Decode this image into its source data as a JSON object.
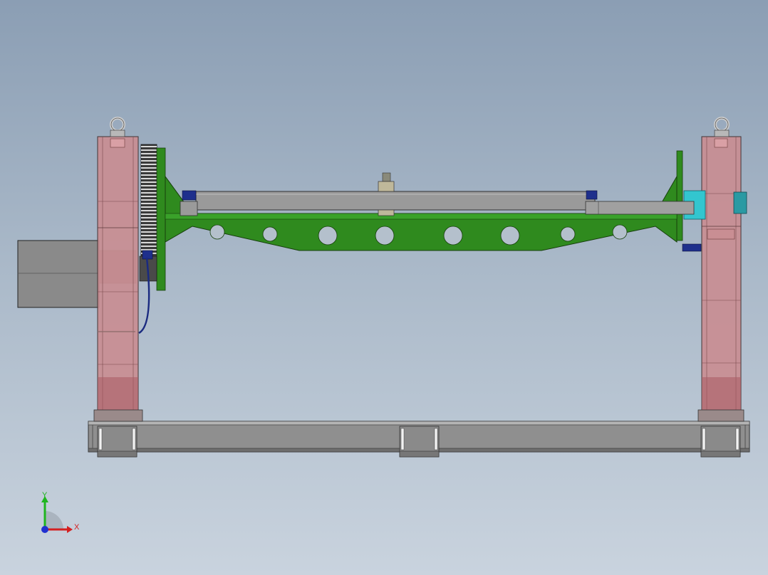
{
  "view": {
    "background_top": "#8b9eb4",
    "background_bottom": "#c9d3de"
  },
  "model": {
    "colors": {
      "frame_red": "#c98e93",
      "frame_red_dark": "#9c6268",
      "fixture_green": "#2f8a1e",
      "fixture_green_dark": "#1f5e12",
      "beam_gray": "#9a9a9a",
      "base_gray": "#8f8f8f",
      "motor_gray": "#8a8a8a",
      "gear_dark": "#3a3a3a",
      "bracket_blue": "#1e2f8c",
      "shaft_cyan": "#33c6cf",
      "cable_blue": "#1a2a80"
    },
    "components": [
      "left-headstock",
      "right-tailstock",
      "flip-fixture-frame",
      "clamp-beam",
      "base-rail",
      "drive-motor",
      "slewing-gear",
      "lifting-eye-left",
      "lifting-eye-right"
    ]
  },
  "triad": {
    "x_label": "X",
    "y_label": "Y",
    "x_color": "#d42020",
    "y_color": "#1fb51f",
    "z_color": "#2030d0"
  }
}
